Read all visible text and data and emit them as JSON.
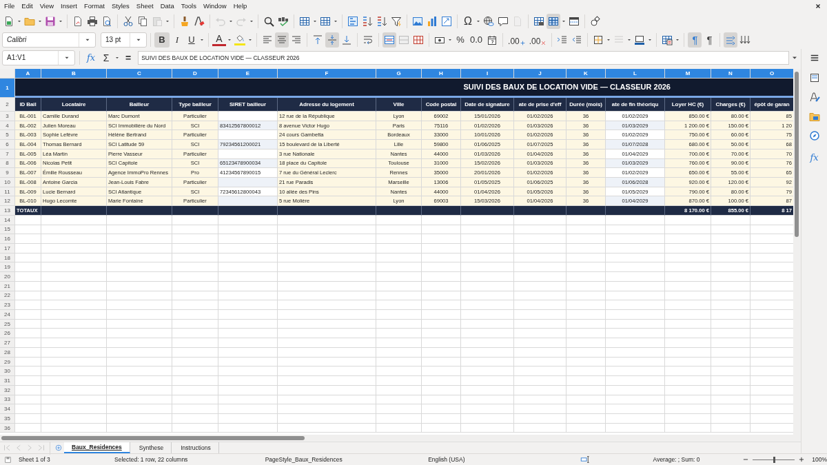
{
  "menu": [
    "File",
    "Edit",
    "View",
    "Insert",
    "Format",
    "Styles",
    "Sheet",
    "Data",
    "Tools",
    "Window",
    "Help"
  ],
  "standard_toolbar": {
    "undo_enabled": false,
    "redo_enabled": false,
    "paste_enabled": false,
    "header_footer_enabled": false,
    "freeze_pressed": true,
    "special_character": "Ω"
  },
  "format_toolbar": {
    "font_name": "Calibri",
    "font_size": "13 pt",
    "bold": {
      "label": "B",
      "pressed": true
    },
    "italic": {
      "label": "I",
      "pressed": false
    },
    "underline": {
      "label": "U",
      "pressed": false
    },
    "font_color": "A",
    "align": {
      "left": false,
      "center": true,
      "right": false
    },
    "valign": {
      "top": false,
      "center": true,
      "bottom": false
    },
    "wrap_pressed": false,
    "merge_center_pressed": true,
    "percent": "%",
    "number": "0.0",
    "add_decimal": ".00",
    "delete_decimal": ".00",
    "border_style_enabled": false,
    "ltr_pressed": true,
    "rtl_pressed": false,
    "paragraph": "¶",
    "text_direction_pressed": true
  },
  "formula_bar": {
    "name_box": "A1:V1",
    "function_wizard": "fx",
    "sum": "Σ",
    "equals": "=",
    "value": "SUIVI DES BAUX DE LOCATION VIDE — CLASSEUR 2026"
  },
  "sidebar": {
    "functions": "fx"
  },
  "sheet": {
    "columns": [
      {
        "letter": "A",
        "selected": true
      },
      {
        "letter": "B",
        "selected": true
      },
      {
        "letter": "C",
        "selected": true
      },
      {
        "letter": "D",
        "selected": true
      },
      {
        "letter": "E",
        "selected": true
      },
      {
        "letter": "F",
        "selected": true
      },
      {
        "letter": "G",
        "selected": true
      },
      {
        "letter": "H",
        "selected": true
      },
      {
        "letter": "I",
        "selected": true
      },
      {
        "letter": "J",
        "selected": true
      },
      {
        "letter": "K",
        "selected": true
      },
      {
        "letter": "L",
        "selected": true
      },
      {
        "letter": "M",
        "selected": true
      },
      {
        "letter": "N",
        "selected": true
      },
      {
        "letter": "O",
        "selected": true
      }
    ],
    "row_headers": [
      {
        "label": "1",
        "selected": true
      },
      {
        "label": "2",
        "selected": false
      },
      {
        "label": "3",
        "selected": false
      },
      {
        "label": "4",
        "selected": false
      },
      {
        "label": "5",
        "selected": false
      },
      {
        "label": "6",
        "selected": false
      },
      {
        "label": "7",
        "selected": false
      },
      {
        "label": "8",
        "selected": false
      },
      {
        "label": "9",
        "selected": false
      },
      {
        "label": "10",
        "selected": false
      },
      {
        "label": "11",
        "selected": false
      },
      {
        "label": "12",
        "selected": false
      },
      {
        "label": "13",
        "selected": false
      },
      {
        "label": "14",
        "selected": false
      },
      {
        "label": "15",
        "selected": false
      },
      {
        "label": "16",
        "selected": false
      },
      {
        "label": "17",
        "selected": false
      },
      {
        "label": "18",
        "selected": false
      },
      {
        "label": "19",
        "selected": false
      },
      {
        "label": "20",
        "selected": false
      },
      {
        "label": "21",
        "selected": false
      },
      {
        "label": "22",
        "selected": false
      },
      {
        "label": "23",
        "selected": false
      },
      {
        "label": "24",
        "selected": false
      },
      {
        "label": "25",
        "selected": false
      },
      {
        "label": "26",
        "selected": false
      },
      {
        "label": "27",
        "selected": false
      },
      {
        "label": "28",
        "selected": false
      },
      {
        "label": "29",
        "selected": false
      },
      {
        "label": "30",
        "selected": false
      },
      {
        "label": "31",
        "selected": false
      },
      {
        "label": "32",
        "selected": false
      },
      {
        "label": "33",
        "selected": false
      },
      {
        "label": "34",
        "selected": false
      },
      {
        "label": "35",
        "selected": false
      },
      {
        "label": "36",
        "selected": false
      }
    ],
    "title": "SUIVI DES BAUX DE LOCATION VIDE — CLASSEUR 2026",
    "headings": [
      "ID Bail",
      "Locataire",
      "Bailleur",
      "Type bailleur",
      "SIRET bailleur",
      "Adresse du logement",
      "Ville",
      "Code postal",
      "Date de signature",
      "ate de prise d'eff",
      "Durée (mois)",
      "ate de fin théoriqu",
      "Loyer HC (€)",
      "Charges (€)",
      "épôt de garan"
    ],
    "rows": [
      {
        "cells": [
          "BL-001",
          "Camille Durand",
          "Marc Dumont",
          "Particulier",
          null,
          "12 rue de la République",
          "Lyon",
          "69002",
          "15/01/2026",
          "01/02/2026",
          "36",
          "01/02/2029",
          "850.00 €",
          "80.00 €",
          "85"
        ]
      },
      {
        "cells": [
          "BL-002",
          "Julien Moreau",
          "SCI Immobilière du Nord",
          "SCI",
          "83412567800012",
          "8 avenue Victor Hugo",
          "Paris",
          "75116",
          "01/02/2026",
          "01/03/2026",
          "36",
          "01/03/2029",
          "1 200.00 €",
          "150.00 €",
          "1 20"
        ]
      },
      {
        "cells": [
          "BL-003",
          "Sophie Lefèvre",
          "Hélène Bertrand",
          "Particulier",
          null,
          "24 cours Gambetta",
          "Bordeaux",
          "33000",
          "10/01/2026",
          "01/02/2026",
          "36",
          "01/02/2029",
          "750.00 €",
          "60.00 €",
          "75"
        ]
      },
      {
        "cells": [
          "BL-004",
          "Thomas Bernard",
          "SCI Latitude 59",
          "SCI",
          "79234561200021",
          "15 boulevard de la Liberté",
          "Lille",
          "59800",
          "01/06/2025",
          "01/07/2025",
          "36",
          "01/07/2028",
          "680.00 €",
          "50.00 €",
          "68"
        ]
      },
      {
        "cells": [
          "BL-005",
          "Léa Martin",
          "Pierre Vasseur",
          "Particulier",
          null,
          "3 rue Nationale",
          "Nantes",
          "44000",
          "01/03/2026",
          "01/04/2026",
          "36",
          "01/04/2029",
          "700.00 €",
          "70.00 €",
          "70"
        ]
      },
      {
        "cells": [
          "BL-006",
          "Nicolas Petit",
          "SCI Capitole",
          "SCI",
          "65123478900034",
          "18 place du Capitole",
          "Toulouse",
          "31000",
          "15/02/2026",
          "01/03/2026",
          "36",
          "01/03/2029",
          "760.00 €",
          "90.00 €",
          "76"
        ]
      },
      {
        "cells": [
          "BL-007",
          "Émilie Rousseau",
          "Agence ImmoPro Rennes",
          "Pro",
          "41234567890015",
          "7 rue du Général Leclerc",
          "Rennes",
          "35000",
          "20/01/2026",
          "01/02/2026",
          "36",
          "01/02/2029",
          "650.00 €",
          "55.00 €",
          "65"
        ]
      },
      {
        "cells": [
          "BL-008",
          "Antoine Garcia",
          "Jean-Louis Fabre",
          "Particulier",
          null,
          "21 rue Paradis",
          "Marseille",
          "13006",
          "01/05/2025",
          "01/06/2025",
          "36",
          "01/06/2028",
          "920.00 €",
          "120.00 €",
          "92"
        ]
      },
      {
        "cells": [
          "BL-009",
          "Lucie Bernard",
          "SCI Atlantique",
          "SCI",
          "72345612800043",
          "10 allée des Pins",
          "Nantes",
          "44000",
          "01/04/2026",
          "01/05/2026",
          "36",
          "01/05/2029",
          "790.00 €",
          "80.00 €",
          "79"
        ]
      },
      {
        "cells": [
          "BL-010",
          "Hugo Lecomte",
          "Marie Fontaine",
          "Particulier",
          null,
          "5 rue Molière",
          "Lyon",
          "69003",
          "15/03/2026",
          "01/04/2026",
          "36",
          "01/04/2029",
          "870.00 €",
          "100.00 €",
          "87"
        ]
      }
    ],
    "totals": {
      "cells": [
        "TOTAUX",
        null,
        null,
        null,
        null,
        null,
        null,
        null,
        null,
        null,
        null,
        null,
        "8 170.00 €",
        "855.00 €",
        "8 17"
      ]
    }
  },
  "sheet_tabs": [
    {
      "label": "Baux_Residences",
      "selected": true
    },
    {
      "label": "Synthese",
      "selected": false
    },
    {
      "label": "Instructions",
      "selected": false
    }
  ],
  "status_bar": {
    "sheet": "Sheet 1 of 3",
    "selection": "Selected: 1 row, 22 columns",
    "page_style": "PageStyle_Baux_Residences",
    "language": "English (USA)",
    "summary": "Average: ; Sum: 0",
    "zoom": {
      "level": 0.5,
      "label": "100%"
    }
  }
}
